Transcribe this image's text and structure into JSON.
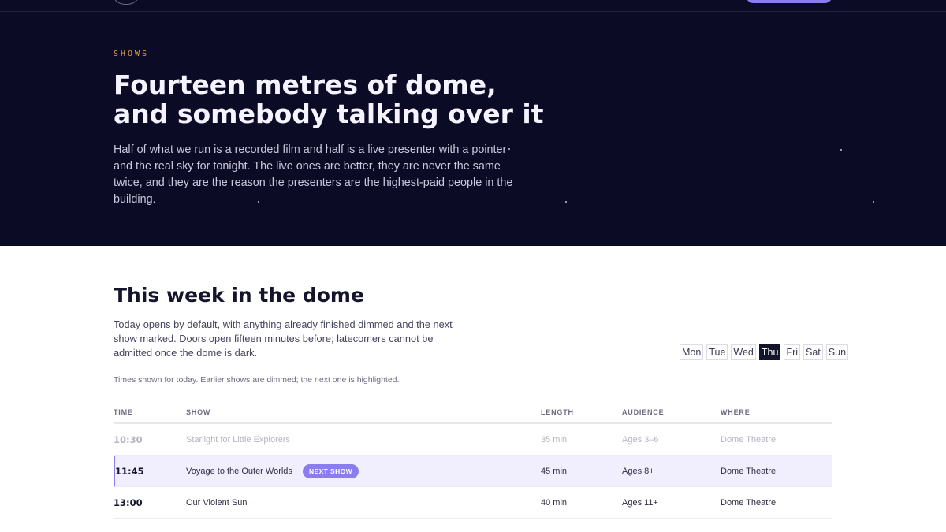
{
  "hero": {
    "eyebrow": "SHOWS",
    "title": "Fourteen metres of dome, and somebody talking over it",
    "body": "Half of what we run is a recorded film and half is a live presenter with a pointer and the real sky for tonight. The live ones are better, they are never the same twice, and they are the reason the presenters are the highest-paid people in the building."
  },
  "schedule": {
    "title": "This week in the dome",
    "description": "Today opens by default, with anything already finished dimmed and the next show marked. Doors open fifteen minutes before; latecomers cannot be admitted once the dome is dark.",
    "days": [
      "Mon",
      "Tue",
      "Wed",
      "Thu",
      "Fri",
      "Sat",
      "Sun"
    ],
    "active_day": "Thu",
    "note": "Times shown for today. Earlier shows are dimmed; the next one is highlighted.",
    "columns": {
      "time": "TIME",
      "show": "SHOW",
      "length": "LENGTH",
      "audience": "AUDIENCE",
      "where": "WHERE"
    },
    "next_badge": "NEXT SHOW",
    "rows": [
      {
        "time": "10:30",
        "show": "Starlight for Little Explorers",
        "length": "35 min",
        "audience": "Ages 3–6",
        "where": "Dome Theatre",
        "state": "past"
      },
      {
        "time": "11:45",
        "show": "Voyage to the Outer Worlds",
        "length": "45 min",
        "audience": "Ages 8+",
        "where": "Dome Theatre",
        "state": "next"
      },
      {
        "time": "13:00",
        "show": "Our Violent Sun",
        "length": "40 min",
        "audience": "Ages 11+",
        "where": "Dome Theatre",
        "state": "upcoming"
      }
    ]
  },
  "colors": {
    "navy": "#0c0b25",
    "accent": "#8b7cf0",
    "eyebrow": "#e0a040"
  }
}
